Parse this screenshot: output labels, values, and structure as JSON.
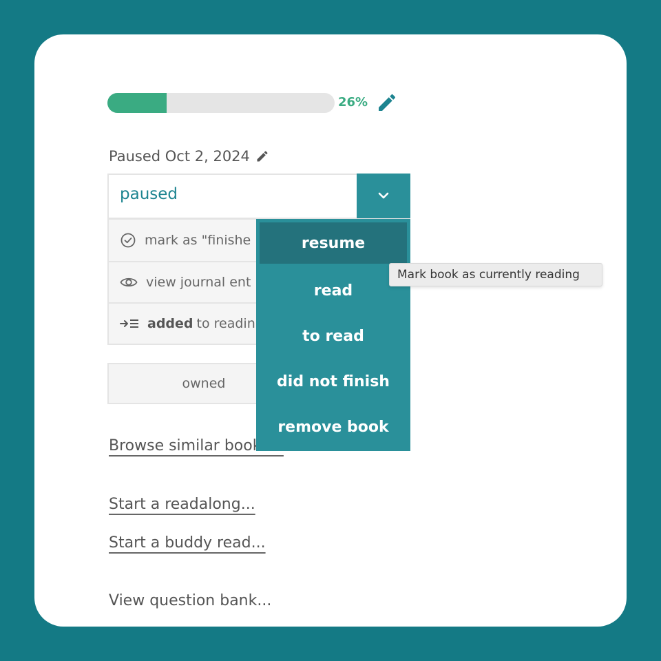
{
  "progress": {
    "fraction": 0.26,
    "label": "26%"
  },
  "status": {
    "text": "Paused Oct 2, 2024"
  },
  "select": {
    "value": "paused"
  },
  "actions": [
    {
      "icon": "check-circle-icon",
      "bold": "",
      "text": "mark as \"finishe"
    },
    {
      "icon": "eye-icon",
      "bold": "",
      "text": "view journal ent"
    },
    {
      "icon": "add-to-list-icon",
      "bold": "added",
      "text": "to readin"
    }
  ],
  "owned": {
    "label": "owned"
  },
  "links": {
    "browse": "Browse similar books...",
    "readalong": "Start a readalong...",
    "buddy": "Start a buddy read...",
    "question_bank": "View question bank..."
  },
  "menu": {
    "items": [
      "resume",
      "read",
      "to read",
      "did not finish",
      "remove book"
    ]
  },
  "tooltip": {
    "text": "Mark book as currently reading"
  },
  "colors": {
    "background": "#147a85",
    "accent": "#2a909a",
    "progress": "#3aab82",
    "select_text": "#1d8490"
  }
}
